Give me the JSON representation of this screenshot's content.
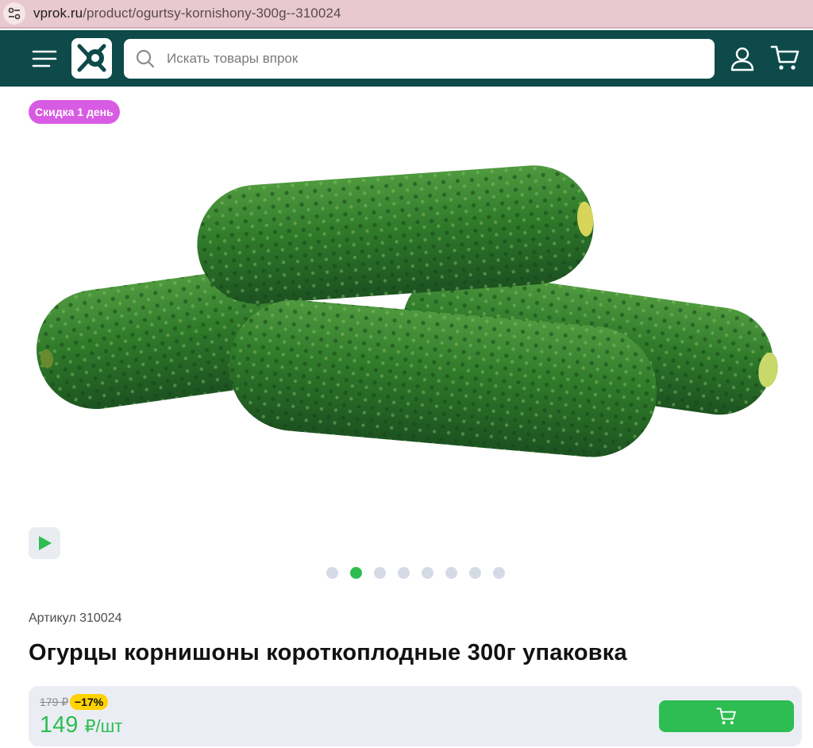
{
  "browser": {
    "url_domain": "vprok.ru",
    "url_path": "/product/ogurtsy-kornishony-300g--310024"
  },
  "header": {
    "search": {
      "placeholder": "Искать товары впрок"
    },
    "colors": {
      "background": "#0e4a4a"
    }
  },
  "product": {
    "badge": "Скидка 1 день",
    "sku_label": "Артикул 310024",
    "title": "Огурцы корнишоны короткоплодные 300г упаковка",
    "gallery": {
      "dots": 8,
      "active_dot": 2
    },
    "old_price": "179 ₽",
    "discount": "−17%",
    "price": "149",
    "price_unit": "₽/шт"
  },
  "colors": {
    "accent": "#2ebd52",
    "badge": "#d85be3",
    "discount": "#ffd200"
  }
}
